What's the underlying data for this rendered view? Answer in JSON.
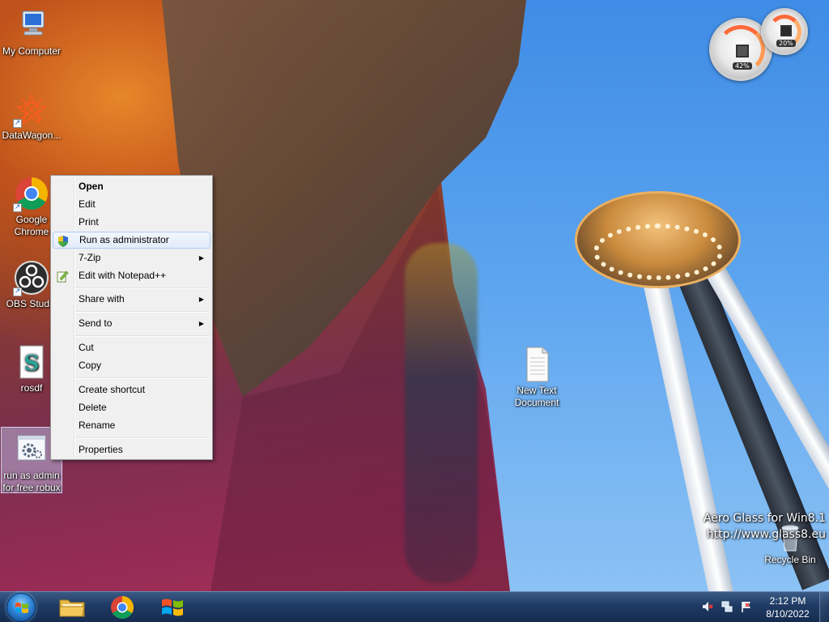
{
  "desktop": {
    "icons": [
      {
        "label": "My Computer"
      },
      {
        "label": "DataWagon..."
      },
      {
        "label": "Google Chrome"
      },
      {
        "label": "OBS Studio"
      },
      {
        "label": "rosdf"
      },
      {
        "label": "run as admin for free robux"
      },
      {
        "label": "New Text Document"
      },
      {
        "label": "Recycle Bin"
      }
    ],
    "watermark": {
      "line1": "Aero Glass for Win8.1",
      "line2": "http://www.glass8.eu"
    }
  },
  "gadget": {
    "cpu_value": "42%",
    "memory_value": "20%",
    "cpu_percent": 42,
    "memory_percent": 20
  },
  "context_menu": {
    "items": [
      {
        "label": "Open"
      },
      {
        "label": "Edit"
      },
      {
        "label": "Print"
      },
      {
        "label": "Run as administrator"
      },
      {
        "label": "7-Zip"
      },
      {
        "label": "Edit with Notepad++"
      },
      {
        "label": "Share with"
      },
      {
        "label": "Send to"
      },
      {
        "label": "Cut"
      },
      {
        "label": "Copy"
      },
      {
        "label": "Create shortcut"
      },
      {
        "label": "Delete"
      },
      {
        "label": "Rename"
      },
      {
        "label": "Properties"
      }
    ],
    "submenu_arrow": "▶"
  },
  "taskbar": {
    "clock_time": "2:12 PM",
    "clock_date": "8/10/2022"
  },
  "colors": {
    "taskbar": "#1f3a63",
    "menu_background": "#f0f0f0",
    "menu_hover_border": "#aecbf2"
  }
}
